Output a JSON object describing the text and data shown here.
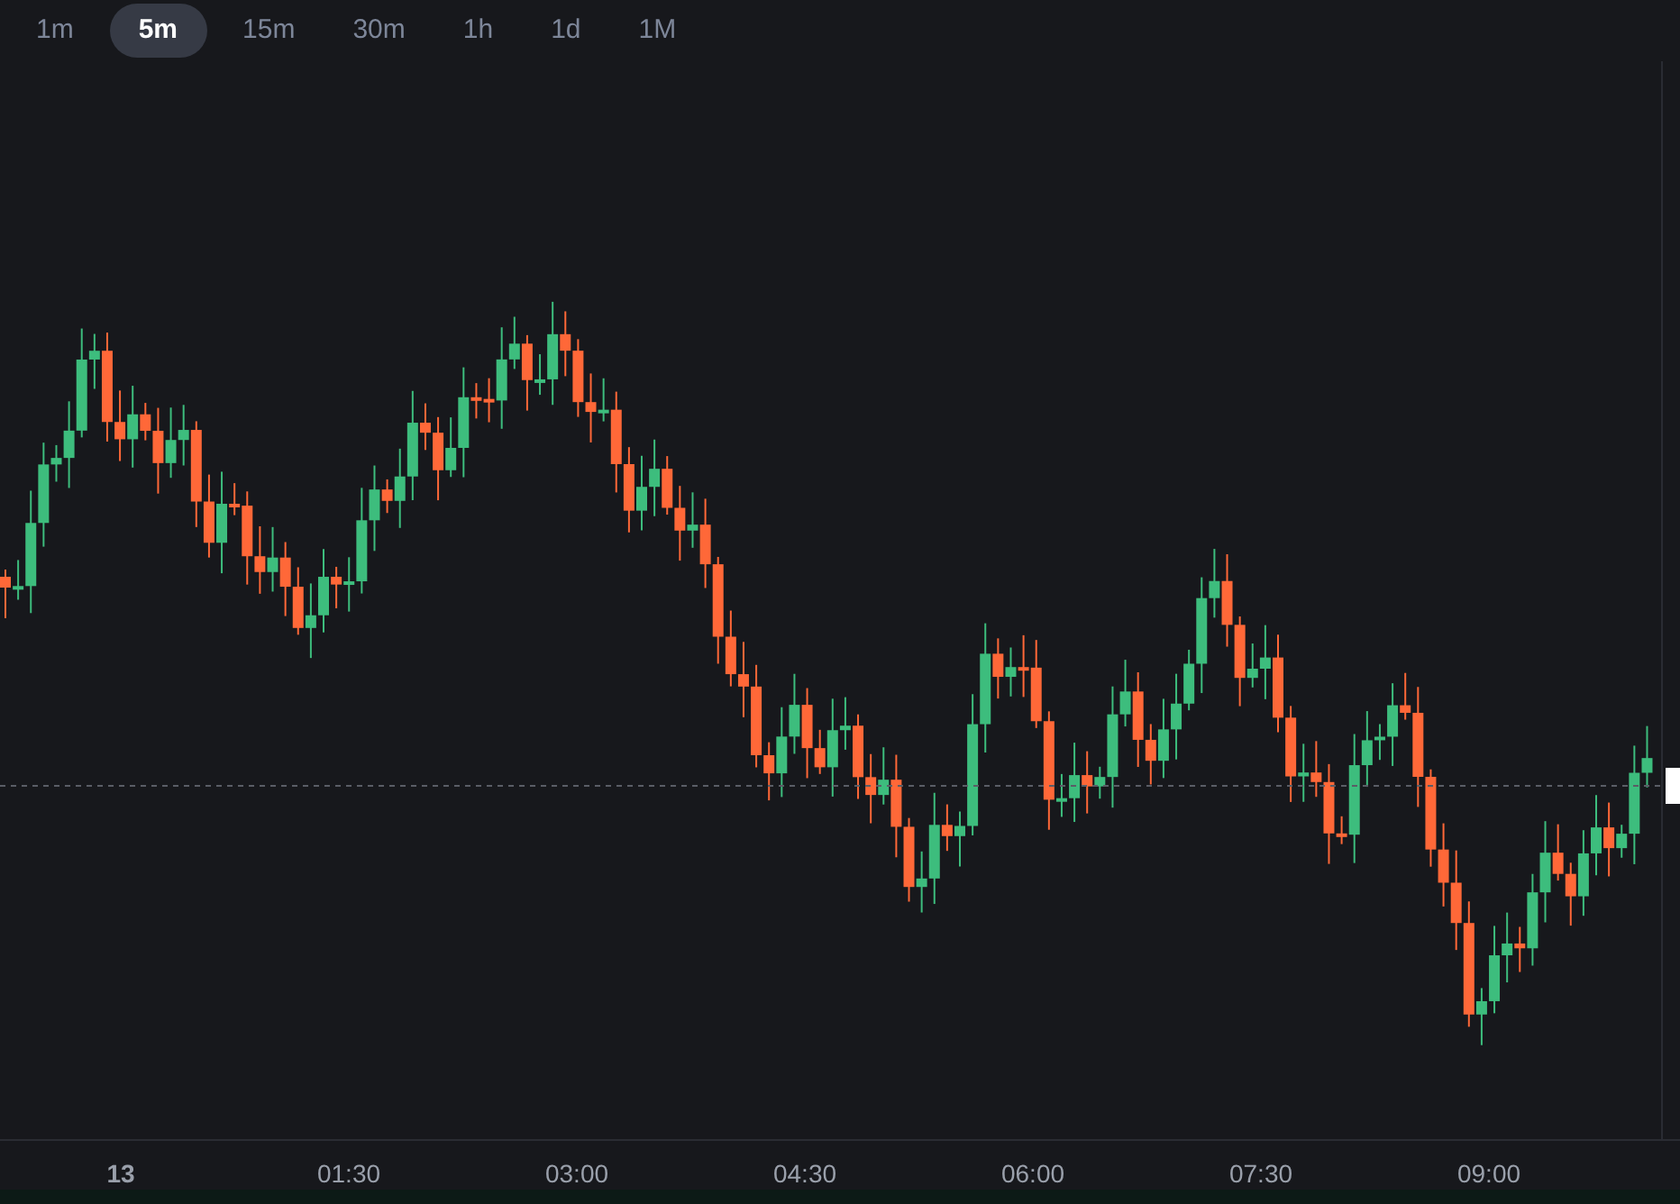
{
  "intervals": [
    {
      "label": "1m",
      "selected": false
    },
    {
      "label": "5m",
      "selected": true
    },
    {
      "label": "15m",
      "selected": false
    },
    {
      "label": "30m",
      "selected": false
    },
    {
      "label": "1h",
      "selected": false
    },
    {
      "label": "1d",
      "selected": false
    },
    {
      "label": "1M",
      "selected": false
    }
  ],
  "time_axis": [
    {
      "label": "13",
      "kind": "day"
    },
    {
      "label": "01:30",
      "kind": "time"
    },
    {
      "label": "03:00",
      "kind": "time"
    },
    {
      "label": "04:30",
      "kind": "time"
    },
    {
      "label": "06:00",
      "kind": "time"
    },
    {
      "label": "07:30",
      "kind": "time"
    },
    {
      "label": "09:00",
      "kind": "time"
    }
  ]
}
